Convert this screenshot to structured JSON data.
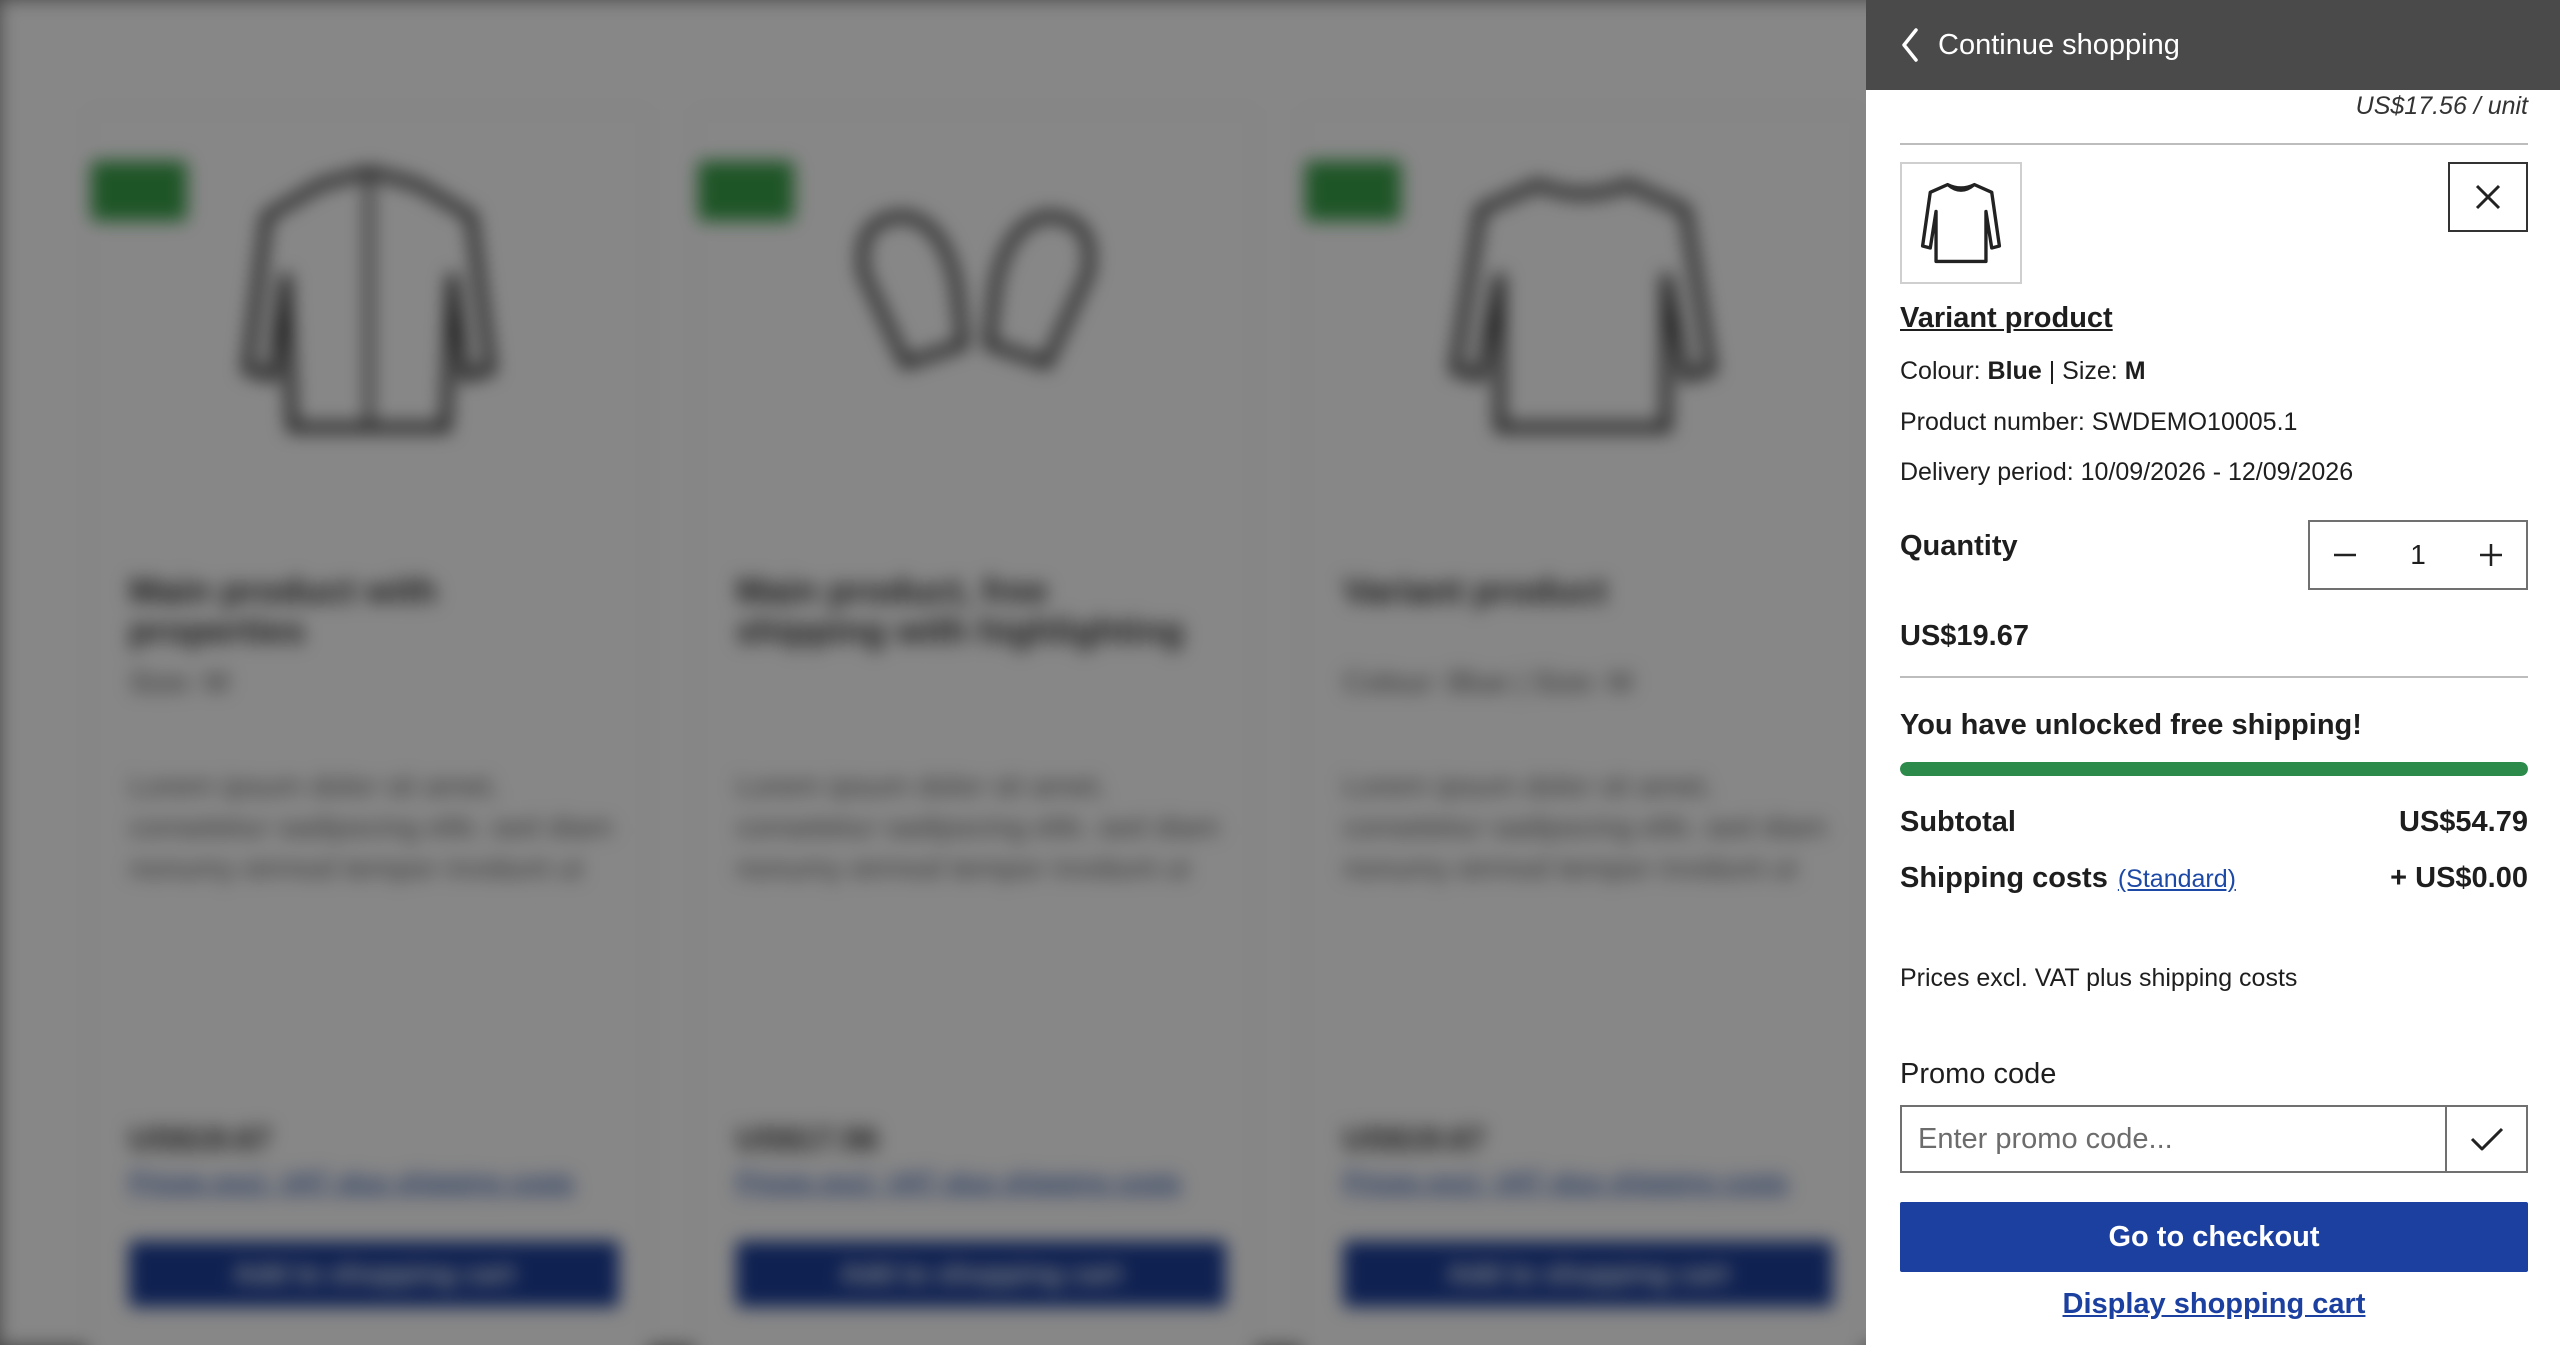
{
  "background": {
    "cards": [
      {
        "title": "Main product with properties",
        "subtitle": "Size: M",
        "description": "Lorem ipsum dolor sit amet, consetetur sadipscing elitr, sed diam nonumy eirmod tempor invidunt ut",
        "price": "US$19.67",
        "link": "Prices excl. VAT plus shipping costs",
        "button": "Add to shopping cart",
        "icon": "jacket-icon"
      },
      {
        "title": "Main product, free shipping with highlighting",
        "subtitle": "",
        "description": "Lorem ipsum dolor sit amet, consetetur sadipscing elitr, sed diam nonumy eirmod tempor invidunt ut",
        "price": "US$17.56",
        "link": "Prices excl. VAT plus shipping costs",
        "button": "Add to shopping cart",
        "icon": "mittens-icon"
      },
      {
        "title": "Variant product",
        "subtitle": "Colour: Blue | Size: M",
        "description": "Lorem ipsum dolor sit amet, consetetur sadipscing elitr, sed diam nonumy eirmod tempor invidunt ut",
        "price": "US$19.67",
        "link": "Prices excl. VAT plus shipping costs",
        "button": "Add to shopping cart",
        "icon": "sweater-icon"
      }
    ]
  },
  "offcanvas": {
    "back_label": "Continue shopping",
    "previous_unit_price": "US$17.56 / unit",
    "item": {
      "name": "Variant product",
      "colour_label": "Colour:",
      "colour_value": "Blue",
      "separator": "|",
      "size_label": "Size:",
      "size_value": "M",
      "product_number_label": "Product number:",
      "product_number": "SWDEMO10005.1",
      "delivery_label": "Delivery period:",
      "delivery_period": "10/09/2026 - 12/09/2026",
      "quantity_label": "Quantity",
      "quantity": "1",
      "total_price": "US$19.67",
      "thumbnail_icon": "sweater-icon"
    },
    "shipping_message": "You have unlocked free shipping!",
    "free_shipping_progress": 1.0,
    "subtotal_label": "Subtotal",
    "subtotal": "US$54.79",
    "shipping_label": "Shipping costs",
    "shipping_method": "(Standard)",
    "shipping_cost": "+ US$0.00",
    "vat_note": "Prices excl. VAT plus shipping costs",
    "promo_label": "Promo code",
    "promo_placeholder": "Enter promo code...",
    "checkout_label": "Go to checkout",
    "display_cart_label": "Display shopping cart"
  },
  "colors": {
    "header_bg": "#4a4a4a",
    "primary": "#1b40a0",
    "success": "#2c8a4b",
    "badge": "#3aa14a"
  }
}
